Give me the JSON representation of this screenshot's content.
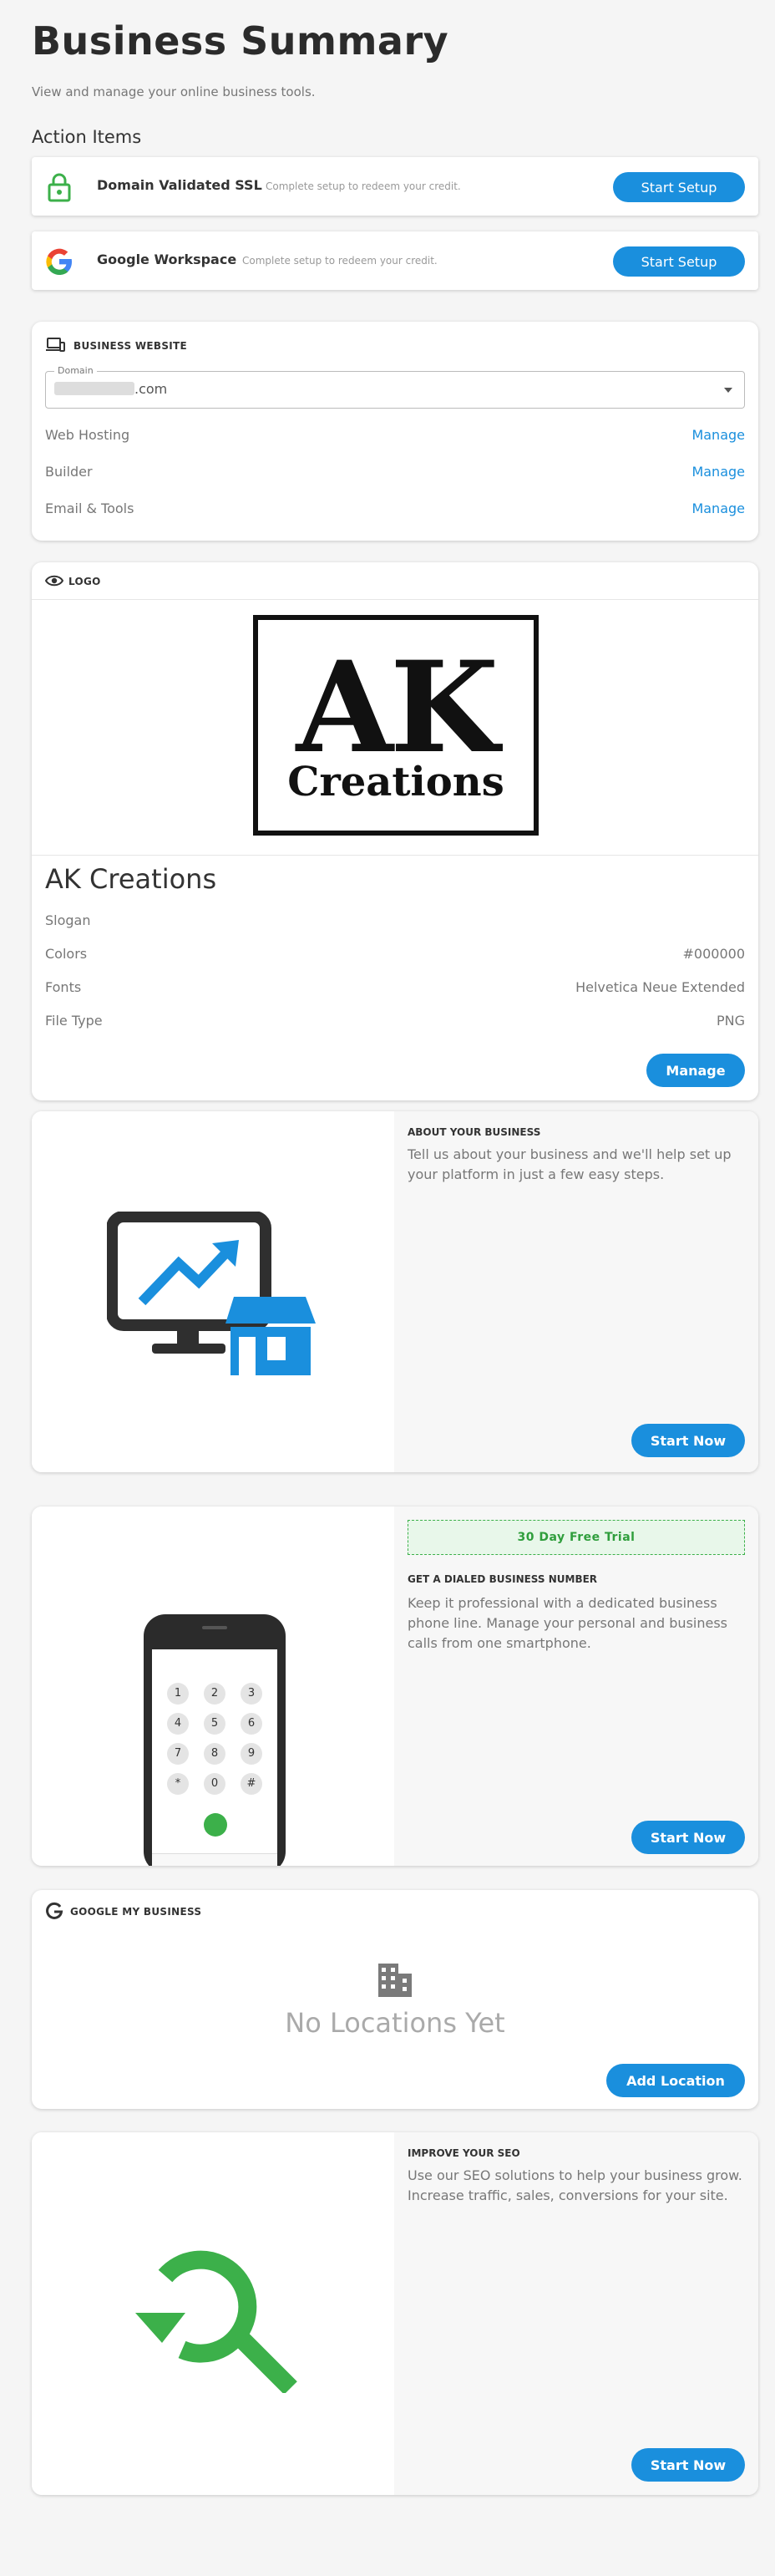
{
  "page": {
    "title": "Business Summary",
    "subtitle": "View and manage your online business tools.",
    "action_heading": "Action Items"
  },
  "actions": [
    {
      "label": "Domain Validated SSL",
      "note": "Complete setup to redeem your credit.",
      "button": "Start Setup",
      "icon": "lock-icon"
    },
    {
      "label": "Google Workspace",
      "note": "Complete setup to redeem your credit.",
      "button": "Start Setup",
      "icon": "google-g-icon"
    }
  ],
  "website": {
    "header": "BUSINESS WEBSITE",
    "domain_label": "Domain",
    "domain_value": ".com",
    "rows": [
      {
        "label": "Web Hosting",
        "link": "Manage"
      },
      {
        "label": "Builder",
        "link": "Manage"
      },
      {
        "label": "Email & Tools",
        "link": "Manage"
      }
    ]
  },
  "logo": {
    "header": "LOGO",
    "logo_text_big": "AK",
    "logo_text_small": "Creations",
    "name": "AK Creations",
    "slogan_label": "Slogan",
    "details": [
      {
        "label": "Colors",
        "value": "#000000"
      },
      {
        "label": "Fonts",
        "value": "Helvetica Neue Extended"
      },
      {
        "label": "File Type",
        "value": "PNG"
      }
    ],
    "button": "Manage"
  },
  "about": {
    "heading": "ABOUT YOUR BUSINESS",
    "text": "Tell us about your business and we'll help set up your platform in just a few easy steps.",
    "button": "Start Now"
  },
  "phone": {
    "trial": "30 Day Free Trial",
    "heading": "GET A DIALED BUSINESS NUMBER",
    "text": "Keep it professional with a dedicated business phone line. Manage your personal and business calls from one smartphone.",
    "button": "Start Now",
    "keys": [
      "1",
      "2",
      "3",
      "4",
      "5",
      "6",
      "7",
      "8",
      "9",
      "*",
      "0",
      "#"
    ]
  },
  "gmb": {
    "header": "GOOGLE MY BUSINESS",
    "empty": "No Locations Yet",
    "button": "Add Location"
  },
  "seo": {
    "heading": "IMPROVE YOUR SEO",
    "text": "Use our SEO solutions to help your business grow. Increase traffic, sales, conversions for your site.",
    "button": "Start Now"
  },
  "colors": {
    "accent": "#1a8fdd",
    "green": "#3cb04a",
    "dark": "#2b2b2b"
  }
}
